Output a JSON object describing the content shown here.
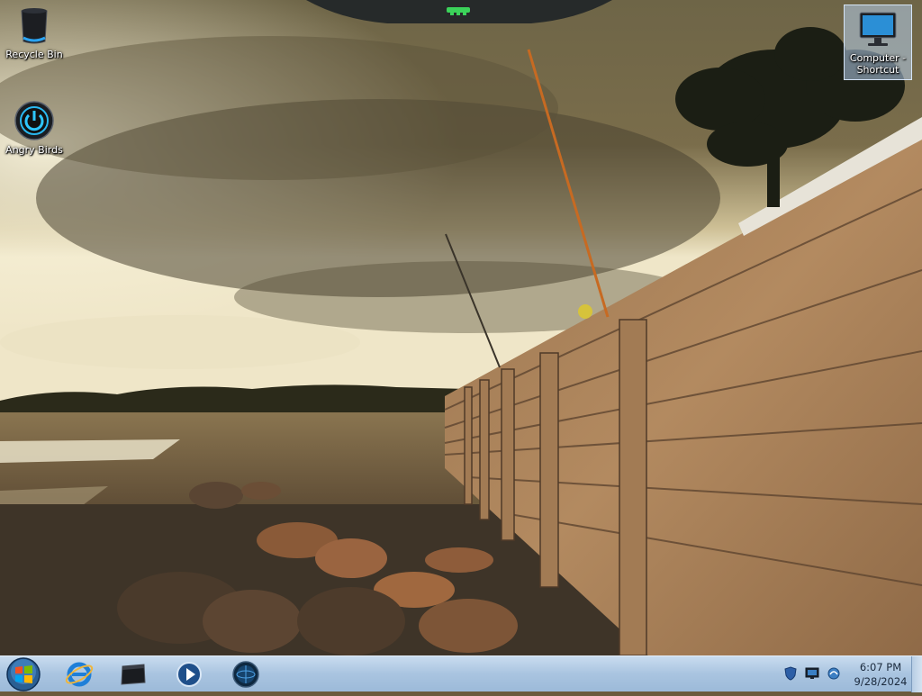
{
  "desktop": {
    "icons": [
      {
        "label": "Recycle Bin",
        "icon": "recycle-bin-icon"
      },
      {
        "label": "Angry Birds",
        "icon": "power-button-icon"
      },
      {
        "label": "Computer - Shortcut",
        "icon": "monitor-icon"
      }
    ]
  },
  "taskbar": {
    "start": {
      "icon": "windows-logo-icon"
    },
    "pinned": [
      {
        "icon": "internet-explorer-icon"
      },
      {
        "icon": "explorer-window-icon"
      },
      {
        "icon": "media-player-icon"
      },
      {
        "icon": "globe-app-icon"
      }
    ],
    "tray": {
      "icons": [
        "shield-icon",
        "monitor-tray-icon",
        "network-icon"
      ],
      "time": "6:07 PM",
      "date": "9/28/2024"
    }
  },
  "colors": {
    "taskbar": "#b5cde6",
    "accent_blue": "#1e6fb8",
    "gadget_green": "#3bd35a"
  }
}
